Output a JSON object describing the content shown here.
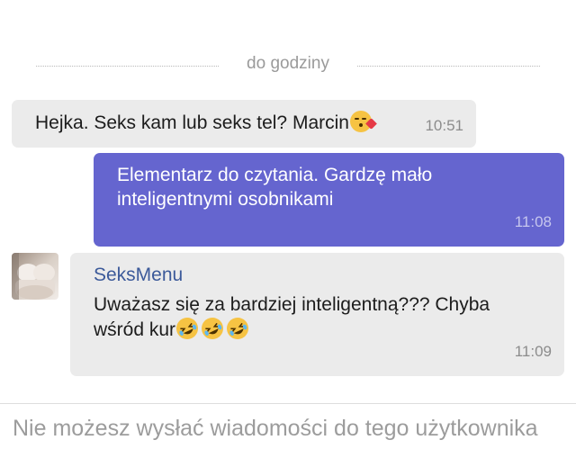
{
  "date_divider": {
    "label": "do godziny"
  },
  "messages": [
    {
      "direction": "incoming",
      "text": "Hejka. Seks kam lub seks tel? Marcin",
      "emoji": "kissing-face-with-heart",
      "time": "10:51"
    },
    {
      "direction": "outgoing",
      "text": "Elementarz do czytania. Gardzę mało inteligentnymi osobnikami",
      "time": "11:08"
    },
    {
      "direction": "incoming",
      "sender": "SeksMenu",
      "text": "Uważasz się za bardziej inteligentną??? Chyba wśród kur",
      "emoji": "rolling-on-floor-laughing x3",
      "time": "11:09"
    }
  ],
  "footer": {
    "notice": "Nie możesz wysłać wiadomości do tego użytkownika"
  },
  "colors": {
    "incoming_bubble": "#ebebeb",
    "outgoing_bubble": "#6565cf",
    "sender_name": "#3c5a9a",
    "muted_text": "#9c9c9c"
  }
}
